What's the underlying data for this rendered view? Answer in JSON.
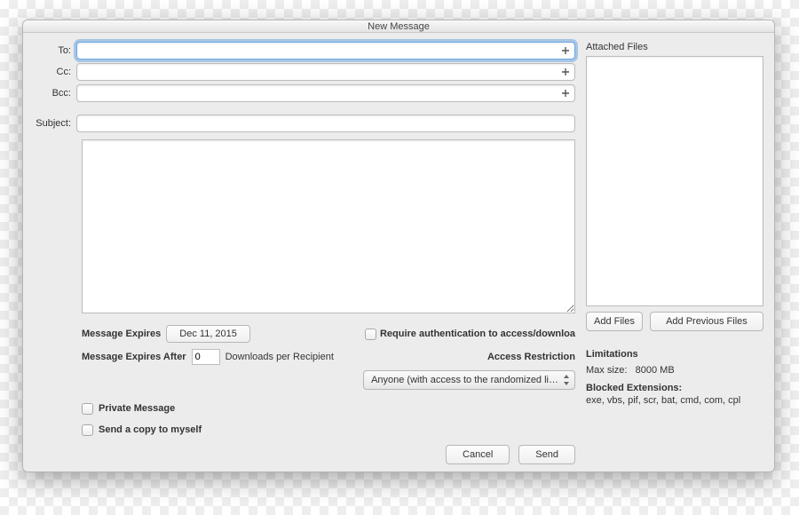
{
  "window": {
    "title": "New Message"
  },
  "fields": {
    "to_label": "To:",
    "cc_label": "Cc:",
    "bcc_label": "Bcc:",
    "subject_label": "Subject:",
    "to_value": "",
    "cc_value": "",
    "bcc_value": "",
    "subject_value": "",
    "body_value": ""
  },
  "options": {
    "message_expires_label": "Message Expires",
    "message_expires_date": "Dec 11, 2015",
    "require_auth_label": "Require authentication to access/downloa",
    "message_expires_after_label": "Message Expires After",
    "downloads_value": "0",
    "downloads_suffix": "Downloads per Recipient",
    "access_restriction_label": "Access Restriction",
    "access_dropdown": "Anyone (with access to the randomized li…",
    "private_message_label": "Private Message",
    "send_copy_label": "Send a copy to myself"
  },
  "buttons": {
    "cancel": "Cancel",
    "send": "Send",
    "add_files": "Add Files",
    "add_previous": "Add Previous Files"
  },
  "side": {
    "attached_files_label": "Attached Files",
    "limitations_label": "Limitations",
    "max_size_label": "Max size:",
    "max_size_value": "8000 MB",
    "blocked_ext_label": "Blocked Extensions:",
    "blocked_ext_value": "exe, vbs, pif, scr, bat, cmd, com, cpl"
  }
}
